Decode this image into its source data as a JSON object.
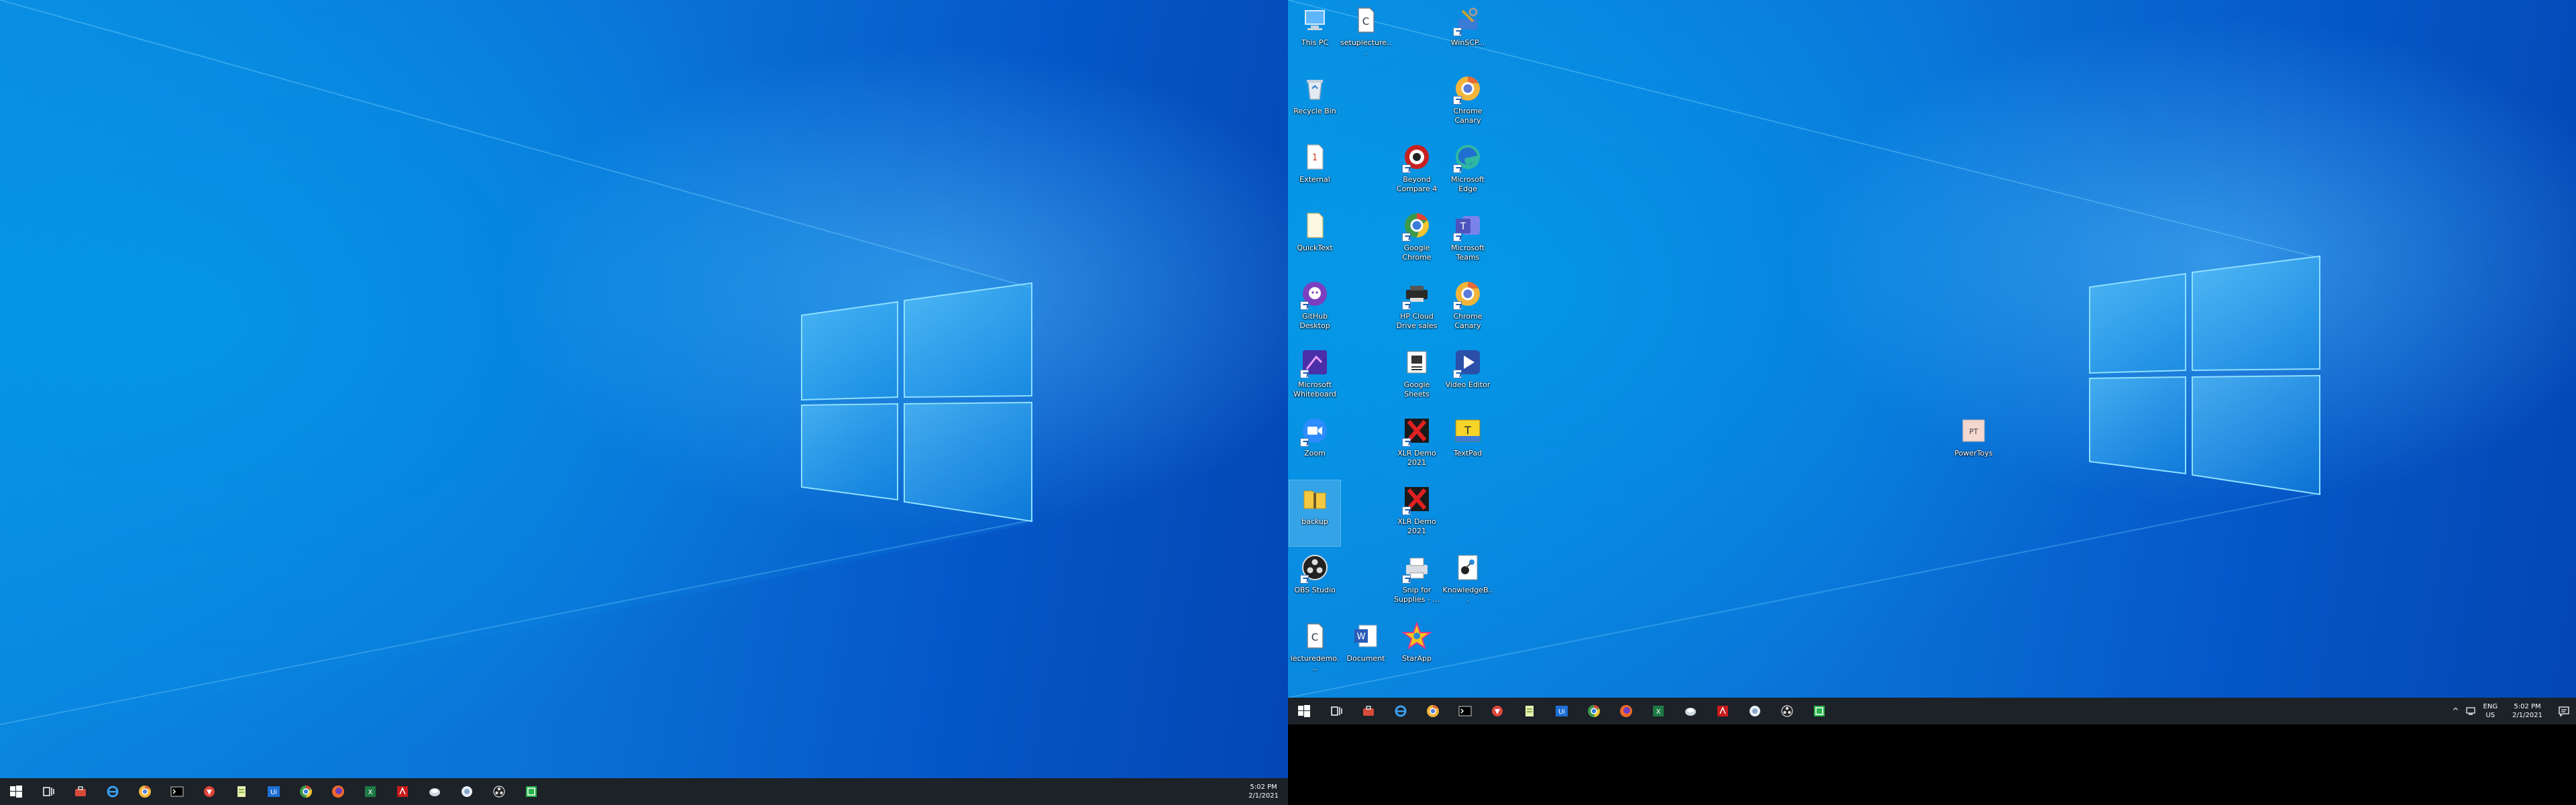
{
  "left_monitor": {
    "taskbar": {
      "pinned": [
        "start-icon",
        "task-view-icon",
        "toolbox-icon",
        "ie-icon",
        "chrome-canary-icon",
        "terminal-icon",
        "foxit-icon",
        "notepad-icon",
        "uipath-icon",
        "chrome-icon",
        "firefox-icon",
        "excel-icon",
        "acrobat-icon",
        "mercury-icon",
        "misc-icon",
        "obs-icon",
        "app-green-icon"
      ],
      "clock": {
        "time": "5:02 PM",
        "date": "2/1/2021"
      }
    }
  },
  "right_monitor": {
    "desktop_icons": [
      {
        "name": "this-pc",
        "label": "This PC",
        "icon": "computer-icon"
      },
      {
        "name": "recycle-bin",
        "label": "Recycle Bin",
        "icon": "recycle-bin-icon"
      },
      {
        "name": "external",
        "label": "External",
        "icon": "text-file-icon"
      },
      {
        "name": "quicktext",
        "label": "QuickText",
        "icon": "blank-file-icon"
      },
      {
        "name": "github-desktop",
        "label": "GitHub Desktop",
        "icon": "github-icon"
      },
      {
        "name": "microsoft-whiteboard",
        "label": "Microsoft Whiteboard",
        "icon": "whiteboard-icon"
      },
      {
        "name": "zoom",
        "label": "Zoom",
        "icon": "zoom-icon"
      },
      {
        "name": "backup",
        "label": "backup",
        "icon": "zip-folder-icon"
      },
      {
        "name": "obs-studio",
        "label": "OBS Studio",
        "icon": "obs-icon"
      },
      {
        "name": "lecturedemo",
        "label": "lecturedemo...",
        "icon": "c-file-icon"
      },
      {
        "name": "setuplecture",
        "label": "setuplecture...",
        "icon": "c-file-icon"
      },
      {
        "name": "word-doc",
        "label": "Document",
        "icon": "word-icon"
      },
      {
        "name": "beyond-compare",
        "label": "Beyond Compare 4",
        "icon": "beyond-compare-icon"
      },
      {
        "name": "google-chrome",
        "label": "Google Chrome",
        "icon": "chrome-icon"
      },
      {
        "name": "hp-usage",
        "label": "HP Cloud Drive sales",
        "icon": "printer-dark-icon"
      },
      {
        "name": "google-sheets",
        "label": "Google Sheets",
        "icon": "chip-icon"
      },
      {
        "name": "xlr-demo-1",
        "label": "XLR Demo 2021",
        "icon": "red-x-icon"
      },
      {
        "name": "xlr-demo-2",
        "label": "XLR Demo 2021",
        "icon": "red-x-icon"
      },
      {
        "name": "snip-supplies",
        "label": "Snip for Supplies - ...",
        "icon": "printer-icon"
      },
      {
        "name": "starapp",
        "label": "StarApp",
        "icon": "star-icon"
      },
      {
        "name": "winscp",
        "label": "WinSCP...",
        "icon": "tools-icon"
      },
      {
        "name": "chrome-canary",
        "label": "Chrome Canary",
        "icon": "chrome-canary-icon"
      },
      {
        "name": "microsoft-edge",
        "label": "Microsoft Edge",
        "icon": "edge-icon"
      },
      {
        "name": "microsoft-teams",
        "label": "Microsoft Teams",
        "icon": "teams-icon"
      },
      {
        "name": "chrome-canary-2",
        "label": "Chrome Canary",
        "icon": "chrome-canary-icon"
      },
      {
        "name": "video-editor",
        "label": "Video Editor",
        "icon": "video-icon"
      },
      {
        "name": "textpad",
        "label": "TextPad",
        "icon": "textpad-icon"
      },
      {
        "name": "knowledge",
        "label": "KnowledgeB...",
        "icon": "molecule-icon"
      },
      {
        "name": "powertoys",
        "label": "PowerToys",
        "icon": "pt-icon"
      }
    ],
    "taskbar": {
      "pinned": [
        "start-icon",
        "task-view-icon",
        "toolbox-icon",
        "edge-icon",
        "chrome-canary-icon",
        "foxit-icon",
        "notepad-icon",
        "uipath-icon",
        "chrome-icon",
        "firefox-icon",
        "excel-icon",
        "mercury-icon",
        "acrobat-icon",
        "misc-icon",
        "obs-icon",
        "app-green-icon",
        "terminal-icon"
      ],
      "tray": {
        "chevron": "^",
        "lang_top": "ENG",
        "lang_bottom": "US"
      },
      "clock": {
        "time": "5:02 PM",
        "date": "2/1/2021"
      }
    }
  },
  "colors": {
    "taskbar": "#1c2228",
    "wallpaper_blue": "#0a73d8",
    "accent": "#39c8ff"
  }
}
